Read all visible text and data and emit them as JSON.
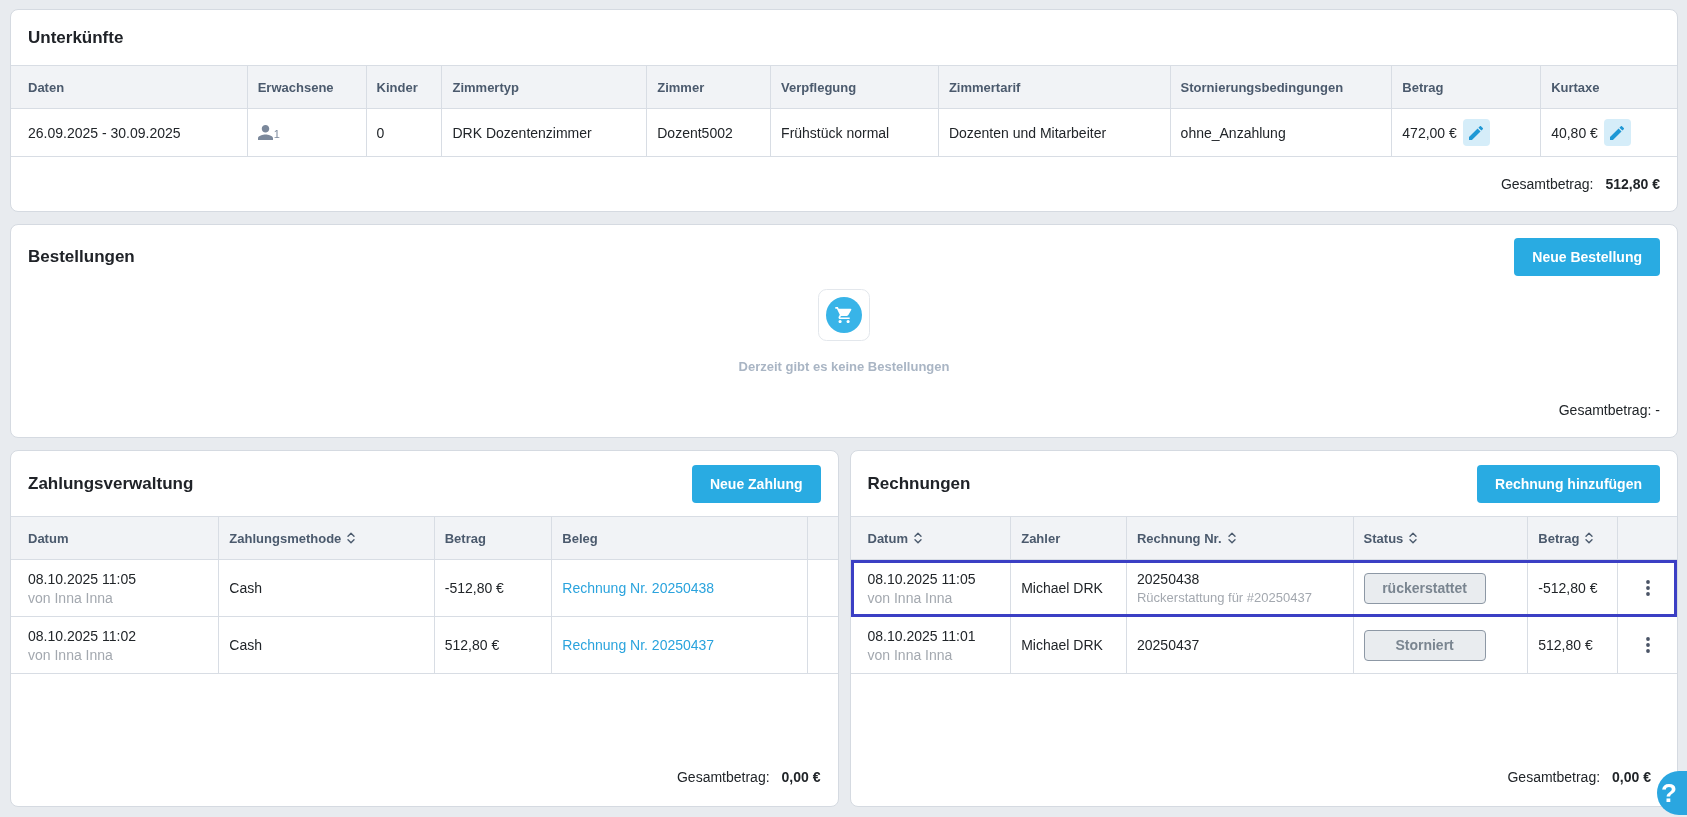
{
  "accommodations": {
    "title": "Unterkünfte",
    "columns": [
      {
        "label": "Daten"
      },
      {
        "label": "Erwachsene"
      },
      {
        "label": "Kinder"
      },
      {
        "label": "Zimmertyp"
      },
      {
        "label": "Zimmer"
      },
      {
        "label": "Verpflegung"
      },
      {
        "label": "Zimmertarif"
      },
      {
        "label": "Stornierungsbedingungen"
      },
      {
        "label": "Betrag"
      },
      {
        "label": "Kurtaxe"
      }
    ],
    "rows": [
      {
        "cells": [
          {
            "kind": "text",
            "text": "26.09.2025 - 30.09.2025"
          },
          {
            "kind": "guests",
            "text": "1"
          },
          {
            "kind": "text",
            "text": "0"
          },
          {
            "kind": "text",
            "text": "DRK Dozentenzimmer"
          },
          {
            "kind": "text",
            "text": "Dozent5002"
          },
          {
            "kind": "text",
            "text": "Frühstück normal"
          },
          {
            "kind": "text",
            "text": "Dozenten und Mitarbeiter"
          },
          {
            "kind": "text",
            "text": "ohne_Anzahlung"
          },
          {
            "kind": "editable",
            "text": "472,00 €"
          },
          {
            "kind": "editable",
            "text": "40,80 €"
          }
        ]
      }
    ],
    "total_label": "Gesamtbetrag:",
    "total": "512,80 €"
  },
  "orders": {
    "title": "Bestellungen",
    "button": "Neue Bestellung",
    "empty_text": "Derzeit gibt es keine Bestellungen",
    "total_label": "Gesamtbetrag:",
    "total": "-"
  },
  "payments": {
    "title": "Zahlungsverwaltung",
    "button": "Neue Zahlung",
    "columns": [
      {
        "label": "Datum",
        "sortable": false
      },
      {
        "label": "Zahlungsmethode",
        "sortable": true
      },
      {
        "label": "Betrag",
        "sortable": false
      },
      {
        "label": "Beleg",
        "sortable": false
      }
    ],
    "rows": [
      {
        "cells": [
          {
            "kind": "datetime",
            "text": "08.10.2025 11:05",
            "sub": "von Inna Inna"
          },
          {
            "kind": "text",
            "text": "Cash"
          },
          {
            "kind": "text",
            "text": "-512,80 €"
          },
          {
            "kind": "link",
            "text": "Rechnung Nr. 20250438"
          }
        ]
      },
      {
        "cells": [
          {
            "kind": "datetime",
            "text": "08.10.2025 11:02",
            "sub": "von Inna Inna"
          },
          {
            "kind": "text",
            "text": "Cash"
          },
          {
            "kind": "text",
            "text": "512,80 €"
          },
          {
            "kind": "link",
            "text": "Rechnung Nr. 20250437"
          }
        ]
      }
    ],
    "total_label": "Gesamtbetrag:",
    "total": "0,00 €"
  },
  "invoices": {
    "title": "Rechnungen",
    "button": "Rechnung hinzufügen",
    "columns": [
      {
        "label": "Datum",
        "sortable": true
      },
      {
        "label": "Zahler",
        "sortable": false
      },
      {
        "label": "Rechnung Nr.",
        "sortable": true
      },
      {
        "label": "Status",
        "sortable": true
      },
      {
        "label": "Betrag",
        "sortable": true
      }
    ],
    "rows": [
      {
        "selected": true,
        "cells": [
          {
            "kind": "datetime",
            "text": "08.10.2025 11:05",
            "sub": "von Inna Inna"
          },
          {
            "kind": "text",
            "text": "Michael DRK"
          },
          {
            "kind": "invoice_number",
            "text": "20250438",
            "sub": "Rückerstattung für #20250437"
          },
          {
            "kind": "status",
            "text": "rückerstattet"
          },
          {
            "kind": "text",
            "text": "-512,80 €"
          },
          {
            "kind": "menu"
          }
        ]
      },
      {
        "selected": false,
        "cells": [
          {
            "kind": "datetime",
            "text": "08.10.2025 11:01",
            "sub": "von Inna Inna"
          },
          {
            "kind": "text",
            "text": "Michael DRK"
          },
          {
            "kind": "invoice_number",
            "text": "20250437"
          },
          {
            "kind": "status",
            "text": "Storniert"
          },
          {
            "kind": "text",
            "text": "512,80 €"
          },
          {
            "kind": "menu"
          }
        ]
      }
    ],
    "total_label": "Gesamtbetrag:",
    "total": "0,00 €"
  },
  "help_button": "?"
}
